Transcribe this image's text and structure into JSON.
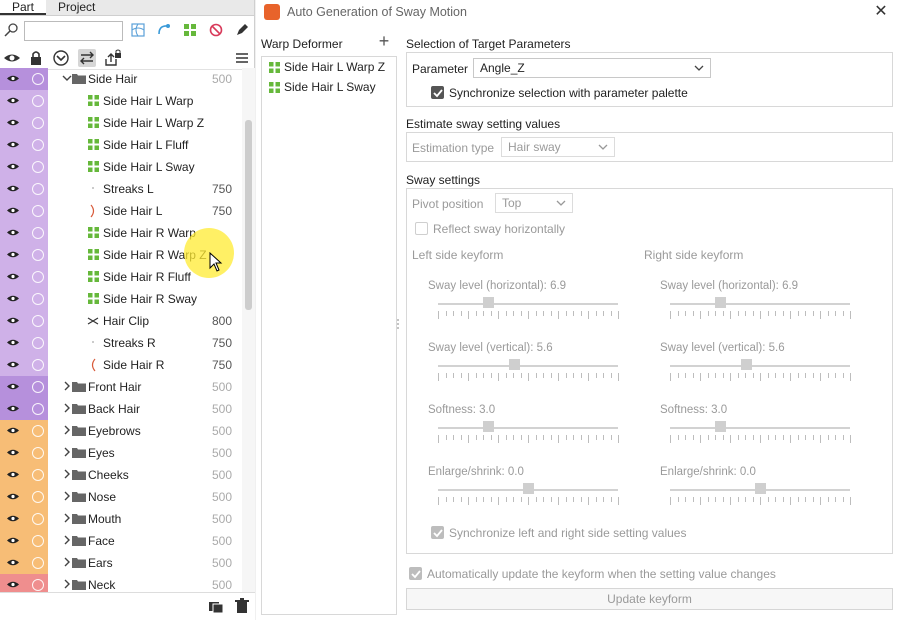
{
  "left_panel": {
    "tabs": [
      {
        "label": "Part",
        "active": true
      },
      {
        "label": "Project",
        "active": false
      }
    ],
    "search": {
      "value": "",
      "placeholder": ""
    },
    "tree_rows": [
      {
        "label": "Side Hair",
        "number": "500",
        "kind": "folder",
        "expanded": true,
        "indent": 0,
        "band": "purple2"
      },
      {
        "label": "Side Hair L Warp",
        "number": "",
        "kind": "deformer",
        "indent": 1,
        "band": "purple"
      },
      {
        "label": "Side Hair L Warp Z",
        "number": "",
        "kind": "deformer",
        "indent": 1,
        "band": "purple"
      },
      {
        "label": "Side Hair L Fluff",
        "number": "",
        "kind": "deformer",
        "indent": 1,
        "band": "purple"
      },
      {
        "label": "Side Hair L Sway",
        "number": "",
        "kind": "deformer",
        "indent": 1,
        "band": "purple"
      },
      {
        "label": "Streaks L",
        "number": "750",
        "kind": "artmesh-dot",
        "indent": 1,
        "band": "purple"
      },
      {
        "label": "Side Hair L",
        "number": "750",
        "kind": "artmesh-curve-red",
        "indent": 1,
        "band": "purple"
      },
      {
        "label": "Side Hair R Warp",
        "number": "",
        "kind": "deformer",
        "indent": 1,
        "band": "purple"
      },
      {
        "label": "Side Hair R Warp Z",
        "number": "",
        "kind": "deformer",
        "indent": 1,
        "band": "purple"
      },
      {
        "label": "Side Hair R Fluff",
        "number": "",
        "kind": "deformer",
        "indent": 1,
        "band": "purple"
      },
      {
        "label": "Side Hair R Sway",
        "number": "",
        "kind": "deformer",
        "indent": 1,
        "band": "purple"
      },
      {
        "label": "Hair Clip",
        "number": "800",
        "kind": "artmesh-clip",
        "indent": 1,
        "band": "purple"
      },
      {
        "label": "Streaks R",
        "number": "750",
        "kind": "artmesh-dot",
        "indent": 1,
        "band": "purple"
      },
      {
        "label": "Side Hair R",
        "number": "750",
        "kind": "artmesh-curve-red-open",
        "indent": 1,
        "band": "purple"
      },
      {
        "label": "Front Hair",
        "number": "500",
        "kind": "folder",
        "expanded": false,
        "indent": 0,
        "band": "purple2"
      },
      {
        "label": "Back Hair",
        "number": "500",
        "kind": "folder",
        "expanded": false,
        "indent": 0,
        "band": "purple2"
      },
      {
        "label": "Eyebrows",
        "number": "500",
        "kind": "folder",
        "expanded": false,
        "indent": 0,
        "band": "orange"
      },
      {
        "label": "Eyes",
        "number": "500",
        "kind": "folder",
        "expanded": false,
        "indent": 0,
        "band": "orange"
      },
      {
        "label": "Cheeks",
        "number": "500",
        "kind": "folder",
        "expanded": false,
        "indent": 0,
        "band": "orange"
      },
      {
        "label": "Nose",
        "number": "500",
        "kind": "folder",
        "expanded": false,
        "indent": 0,
        "band": "orange"
      },
      {
        "label": "Mouth",
        "number": "500",
        "kind": "folder",
        "expanded": false,
        "indent": 0,
        "band": "orange"
      },
      {
        "label": "Face",
        "number": "500",
        "kind": "folder",
        "expanded": false,
        "indent": 0,
        "band": "orange"
      },
      {
        "label": "Ears",
        "number": "500",
        "kind": "folder",
        "expanded": false,
        "indent": 0,
        "band": "orange"
      },
      {
        "label": "Neck",
        "number": "500",
        "kind": "folder",
        "expanded": false,
        "indent": 0,
        "band": "red"
      }
    ],
    "colors": {
      "purple": "#cfb1e8",
      "purple2": "#b690dc",
      "orange": "#f7bd76",
      "red": "#ef8e8e"
    }
  },
  "dialog": {
    "title": "Auto Generation of Sway Motion",
    "warp_deformer": {
      "label": "Warp Deformer",
      "items": [
        "Side Hair L Warp Z",
        "Side Hair L Sway"
      ]
    },
    "target_params": {
      "section_title": "Selection of Target Parameters",
      "parameter_label": "Parameter",
      "parameter_value": "Angle_Z",
      "sync_label": "Synchronize selection with parameter palette",
      "sync_checked": true
    },
    "estimate": {
      "section_title": "Estimate sway setting values",
      "type_label": "Estimation type",
      "type_value": "Hair sway"
    },
    "sway_settings": {
      "section_title": "Sway settings",
      "pivot_label": "Pivot position",
      "pivot_value": "Top",
      "reflect_label": "Reflect sway horizontally",
      "reflect_checked": false,
      "left_title": "Left side keyform",
      "right_title": "Right side keyform",
      "left": [
        {
          "label": "Sway level (horizontal): 6.9",
          "level": 0.28
        },
        {
          "label": "Sway level (vertical): 5.6",
          "level": 0.42
        },
        {
          "label": "Softness: 3.0",
          "level": 0.28
        },
        {
          "label": "Enlarge/shrink: 0.0",
          "level": 0.5
        }
      ],
      "right": [
        {
          "label": "Sway level (horizontal): 6.9",
          "level": 0.28
        },
        {
          "label": "Sway level (vertical): 5.6",
          "level": 0.42
        },
        {
          "label": "Softness: 3.0",
          "level": 0.28
        },
        {
          "label": "Enlarge/shrink: 0.0",
          "level": 0.5
        }
      ],
      "sync_lr_label": "Synchronize left and right side setting values",
      "sync_lr_checked": true
    },
    "auto_update_label": "Automatically update the keyform when the setting value changes",
    "auto_update_checked": true,
    "update_button": "Update keyform"
  }
}
